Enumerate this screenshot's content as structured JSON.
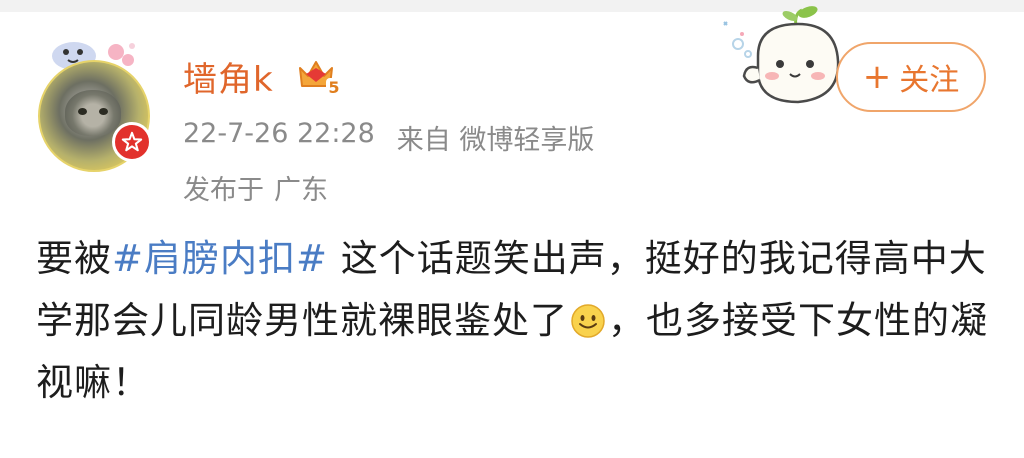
{
  "post": {
    "author": {
      "name": "墙角k",
      "vip_level": "5"
    },
    "meta": {
      "timestamp": "22-7-26 22:28",
      "source_prefix": "来自",
      "source": "微博轻享版"
    },
    "location": {
      "prefix": "发布于",
      "place": "广东"
    },
    "follow_button": {
      "label": "关注",
      "icon": "plus"
    },
    "body": {
      "part1": "要被",
      "hashtag": "#肩膀内扣#",
      "part2": " 这个话题笑出声，挺好的我记得高中大学那会儿同龄男性就裸眼鉴处了",
      "emoji": "smile-emoji",
      "part3": "，也多接受下女性的凝视嘛！"
    }
  },
  "colors": {
    "username": "#e0662b",
    "hashtag": "#4a7cc4",
    "meta_text": "#8a8a8a",
    "follow_border": "#f0a56a",
    "follow_text": "#e8762f",
    "verified_badge": "#e2312c"
  }
}
